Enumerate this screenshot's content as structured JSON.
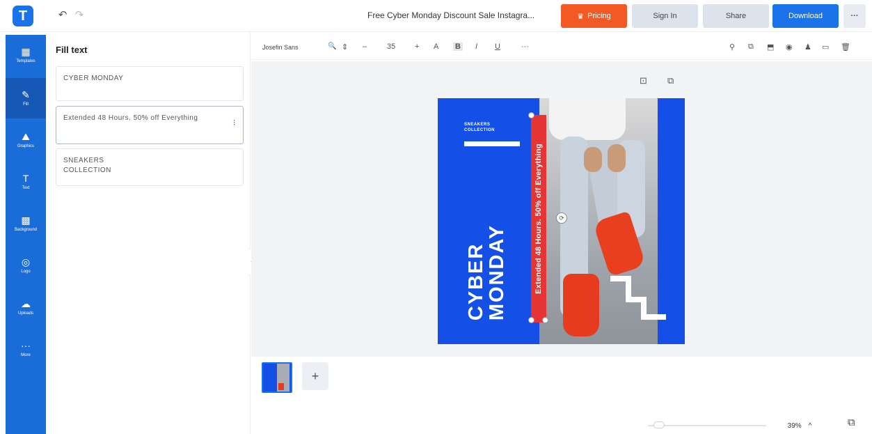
{
  "topbar": {
    "logo": "T",
    "undo_icon": "↶",
    "redo_icon": "↷",
    "title": "Free Cyber Monday Discount Sale Instagra...",
    "pricing": "Pricing",
    "pricing_icon": "♛",
    "signin": "Sign In",
    "share": "Share",
    "download": "Download",
    "more": "···"
  },
  "rail": {
    "items": [
      {
        "label": "Templates",
        "icon": "▦"
      },
      {
        "label": "Fill",
        "icon": "✎"
      },
      {
        "label": "Graphics",
        "icon": "⛰"
      },
      {
        "label": "Text",
        "icon": "T"
      },
      {
        "label": "Background",
        "icon": "▩"
      },
      {
        "label": "Logo",
        "icon": "◎"
      },
      {
        "label": "Uploads",
        "icon": "☁"
      },
      {
        "label": "More",
        "icon": "···"
      }
    ]
  },
  "panel": {
    "title": "Fill text",
    "fields": [
      "CYBER MONDAY",
      "Extended 48 Hours. 50% off Everything",
      "SNEAKERS COLLECTION"
    ],
    "grip_icon": "⁝",
    "collapse_icon": "‹"
  },
  "toolbar": {
    "font": "Josefin Sans",
    "search_icon": "🔍",
    "stepper_icon": "⇕",
    "minus": "–",
    "size": "35",
    "plus": "+",
    "text_color": "A",
    "bold": "B",
    "italic": "I",
    "underline": "U",
    "more": "···",
    "right_icons": [
      "⚲",
      "⧉",
      "⬒",
      "◉",
      "♟",
      "▭",
      "🗑"
    ]
  },
  "canvas": {
    "icons": [
      "⊡",
      "⧉"
    ],
    "poster": {
      "sneakers": "SNEAKERS COLLECTION",
      "cyber_line1": "CYBER",
      "cyber_line2": "MONDAY",
      "extended": "Extended 48 Hours. 50% off Everything",
      "rotate_icon": "⟳"
    }
  },
  "pages": {
    "add": "+",
    "zoom": "39%",
    "zoom_caret": "^",
    "pages_icon": "⧉"
  }
}
